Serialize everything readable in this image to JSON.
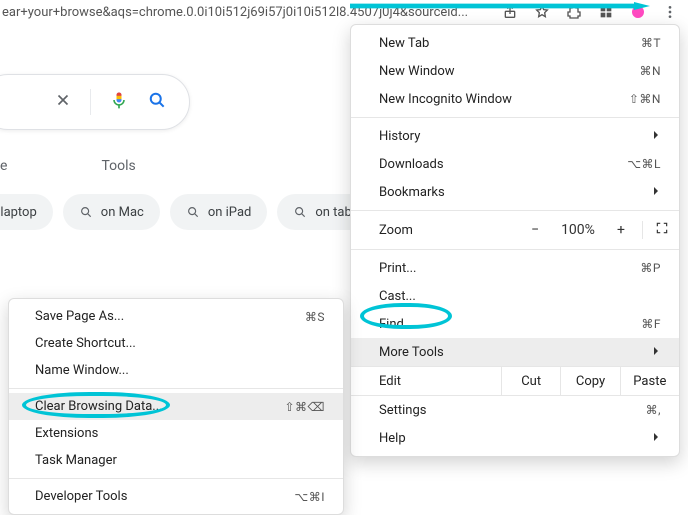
{
  "addressbar": {
    "url_fragment": "ear+your+browse&aqs=chrome.0.0i10i512j69i57j0i10i512l8.4507j0j4&sourceid..."
  },
  "search": {
    "tabs": {
      "left_partial": "e",
      "tools": "Tools"
    },
    "chips": [
      {
        "label": "n laptop"
      },
      {
        "label": "on Mac"
      },
      {
        "label": "on iPad"
      },
      {
        "label": "on tabl"
      }
    ]
  },
  "menu": {
    "new_tab": {
      "label": "New Tab",
      "accel": "⌘T"
    },
    "new_window": {
      "label": "New Window",
      "accel": "⌘N"
    },
    "new_incognito": {
      "label": "New Incognito Window",
      "accel": "⇧⌘N"
    },
    "history": {
      "label": "History"
    },
    "downloads": {
      "label": "Downloads",
      "accel": "⌥⌘L"
    },
    "bookmarks": {
      "label": "Bookmarks"
    },
    "zoom": {
      "label": "Zoom",
      "percent": "100%"
    },
    "print": {
      "label": "Print...",
      "accel": "⌘P"
    },
    "cast": {
      "label": "Cast..."
    },
    "find": {
      "label": "Find...",
      "accel": "⌘F"
    },
    "more_tools": {
      "label": "More Tools"
    },
    "edit": {
      "label": "Edit",
      "cut": "Cut",
      "copy": "Copy",
      "paste": "Paste"
    },
    "settings": {
      "label": "Settings",
      "accel": "⌘,"
    },
    "help": {
      "label": "Help"
    }
  },
  "submenu": {
    "save_page": {
      "label": "Save Page As...",
      "accel": "⌘S"
    },
    "create_shortcut": {
      "label": "Create Shortcut..."
    },
    "name_window": {
      "label": "Name Window..."
    },
    "clear_browsing": {
      "label": "Clear Browsing Data...",
      "accel": "⇧⌘⌫"
    },
    "extensions": {
      "label": "Extensions"
    },
    "task_manager": {
      "label": "Task Manager"
    },
    "developer_tools": {
      "label": "Developer Tools",
      "accel": "⌥⌘I"
    }
  }
}
